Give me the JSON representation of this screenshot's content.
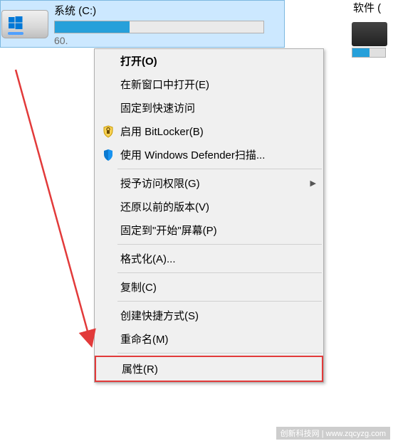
{
  "drives": {
    "c": {
      "label": "系统 (C:)",
      "sub": "60.",
      "fill_percent": 36
    },
    "partial": {
      "label": "软件 ("
    }
  },
  "menu": {
    "open": "打开(O)",
    "open_new_window": "在新窗口中打开(E)",
    "pin_quick_access": "固定到快速访问",
    "bitlocker": "启用 BitLocker(B)",
    "defender_scan": "使用 Windows Defender扫描...",
    "give_access": "授予访问权限(G)",
    "restore_previous": "还原以前的版本(V)",
    "pin_start": "固定到\"开始\"屏幕(P)",
    "format": "格式化(A)...",
    "copy": "复制(C)",
    "create_shortcut": "创建快捷方式(S)",
    "rename": "重命名(M)",
    "properties": "属性(R)"
  },
  "watermark": "创新科技网 | www.zqcyzg.com"
}
